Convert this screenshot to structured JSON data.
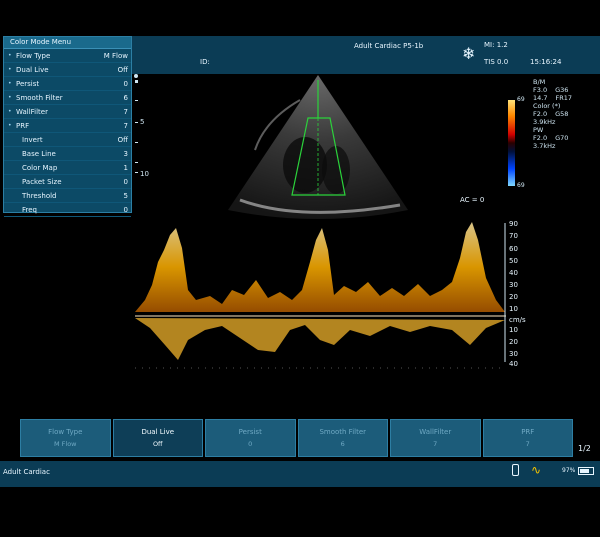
{
  "menu": {
    "title": "Color Mode Menu",
    "rows": [
      {
        "bullet": "•",
        "label": "Flow Type",
        "value": "M Flow"
      },
      {
        "bullet": "•",
        "label": "Dual Live",
        "value": "Off"
      },
      {
        "bullet": "•",
        "label": "Persist",
        "value": "0"
      },
      {
        "bullet": "•",
        "label": "Smooth Filter",
        "value": "6"
      },
      {
        "bullet": "•",
        "label": "WallFilter",
        "value": "7"
      },
      {
        "bullet": "•",
        "label": "PRF",
        "value": "7"
      },
      {
        "bullet": "",
        "label": "Invert",
        "value": "Off"
      },
      {
        "bullet": "",
        "label": "Base Line",
        "value": "3"
      },
      {
        "bullet": "",
        "label": "Color Map",
        "value": "1"
      },
      {
        "bullet": "",
        "label": "Packet Size",
        "value": "0"
      },
      {
        "bullet": "",
        "label": "Threshold",
        "value": "5"
      },
      {
        "bullet": "",
        "label": "Freq",
        "value": "0"
      }
    ]
  },
  "header": {
    "id_label": "ID:",
    "preset": "Adult Cardiac P5-1b",
    "mi": "MI: 1.2",
    "tis": "TIS 0.0",
    "time": "15:16:24"
  },
  "params": [
    "B/M",
    "F3.0",
    "G36",
    "14.7",
    "FR17",
    "Color (*)",
    "F2.0",
    "G58",
    "3.9kHz",
    "PW",
    "F2.0",
    "G70",
    "3.7kHz"
  ],
  "colorbar": {
    "top": "69",
    "bottom": "69"
  },
  "ac": "AC = 0",
  "depth": {
    "top": "5",
    "bottom": "10"
  },
  "doppler_axis": [
    "90",
    "70",
    "60",
    "50",
    "40",
    "30",
    "20",
    "10",
    "cm/s",
    "10",
    "20",
    "30",
    "40"
  ],
  "softkeys": [
    {
      "label": "Flow Type",
      "value": "M Flow",
      "active": false
    },
    {
      "label": "Dual Live",
      "value": "Off",
      "active": true
    },
    {
      "label": "Persist",
      "value": "0",
      "active": false
    },
    {
      "label": "Smooth Filter",
      "value": "6",
      "active": false
    },
    {
      "label": "WallFilter",
      "value": "7",
      "active": false
    },
    {
      "label": "PRF",
      "value": "7",
      "active": false
    }
  ],
  "pager": "1/2",
  "status": {
    "mode": "Adult Cardiac",
    "battery": "97%"
  },
  "icons": {
    "freeze": "snowflake-icon",
    "usb": "usb-icon",
    "wave": "ecg-wave-icon",
    "battery": "battery-icon"
  }
}
